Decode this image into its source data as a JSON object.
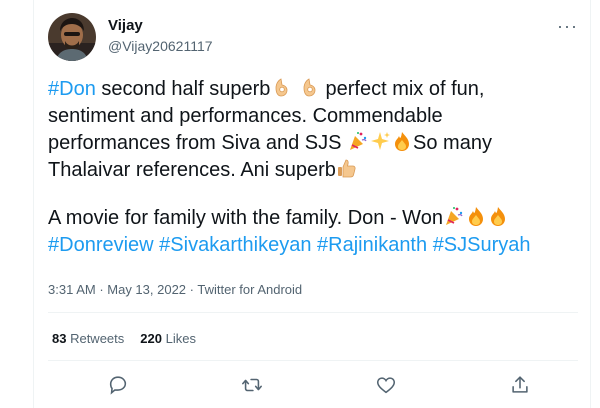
{
  "author": {
    "name": "Vijay",
    "handle": "@Vijay20621117"
  },
  "more_label": "···",
  "tweet": {
    "l1_tag": "#Don",
    "l1_text": " second half superb",
    "l1_text2": " perfect mix of fun,",
    "l2_text": "sentiment and performances. Commendable",
    "l3_text": "performances from Siva and SJS ",
    "l3_text2": "So many",
    "l4_text": "Thalaivar references. Ani superb",
    "l5_text": "A movie for family with the family. Don - Won",
    "tags": [
      "#Donreview",
      "#Sivakarthikeyan",
      "#Rajinikanth",
      "#SJSuryah"
    ]
  },
  "meta": {
    "time": "3:31 AM",
    "date": "May 13, 2022",
    "source": "Twitter for Android",
    "dot": " · "
  },
  "stats": {
    "retweets_count": "83",
    "retweets_label": " Retweets",
    "likes_count": "220",
    "likes_label": " Likes"
  },
  "actions": [
    "reply-icon",
    "retweet-icon",
    "like-icon",
    "share-icon"
  ],
  "colors": {
    "hashtag": "#1d9bf0",
    "secondary": "#536471",
    "text": "#0f1419",
    "divider": "#eff3f4"
  }
}
